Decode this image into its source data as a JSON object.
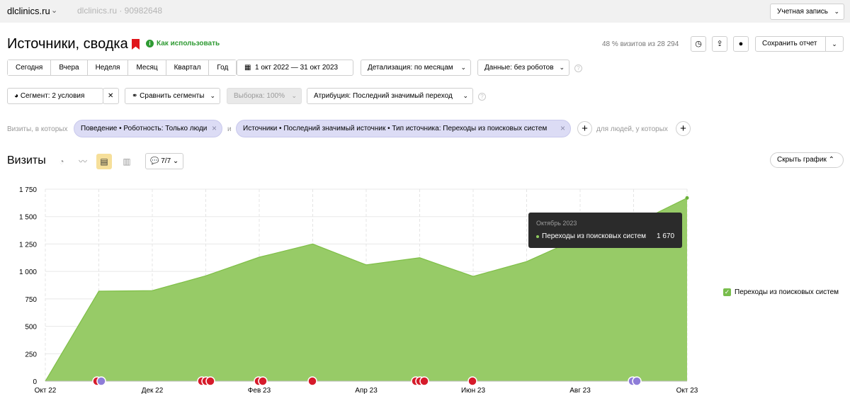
{
  "header": {
    "site": "dlclinics.ru",
    "counter": "dlclinics.ru · 90982648",
    "account": "Учетная запись"
  },
  "report": {
    "title": "Источники, сводка",
    "howto": "Как использовать",
    "visits_share": "48 % визитов из 28 294",
    "save": "Сохранить отчет"
  },
  "filters": {
    "periods": [
      "Сегодня",
      "Вчера",
      "Неделя",
      "Месяц",
      "Квартал",
      "Год"
    ],
    "date_range": "1 окт 2022 — 31 окт 2023",
    "detail": "Детализация: по месяцам",
    "data": "Данные: без роботов",
    "segment": "Сегмент: 2 условия",
    "compare": "Сравнить сегменты",
    "sample": "Выборка: 100%",
    "attribution": "Атрибуция: Последний значимый переход"
  },
  "segments": {
    "label": "Визиты, в которых",
    "chip1": "Поведение • Роботность: Только люди",
    "and": "и",
    "chip2": "Источники • Последний значимый источник • Тип источника: Переходы из поисковых систем",
    "people": "для людей, у которых"
  },
  "chart_section": {
    "title": "Визиты",
    "annotations": "7/7",
    "hide": "Скрыть график"
  },
  "tooltip": {
    "title": "Октябрь 2023",
    "series": "Переходы из поисковых систем",
    "value": "1 670"
  },
  "colors": {
    "area": "#97cb67",
    "accent": "#e0151a",
    "green": "#2e9a32"
  },
  "chart_data": {
    "type": "area",
    "x": [
      "2022-10",
      "2022-11",
      "2022-12",
      "2023-01",
      "2023-02",
      "2023-03",
      "2023-04",
      "2023-05",
      "2023-06",
      "2023-07",
      "2023-08",
      "2023-09",
      "2023-10"
    ],
    "xtick_labels": [
      "Окт 22",
      "Дек 22",
      "Фев 23",
      "Апр 23",
      "Июн 23",
      "Авг 23",
      "Окт 23"
    ],
    "xtick_index": [
      0,
      2,
      4,
      6,
      8,
      10,
      12
    ],
    "yticks": [
      0,
      250,
      500,
      750,
      1000,
      1250,
      1500,
      1750
    ],
    "ytick_labels": [
      "0",
      "250",
      "500",
      "750",
      "1 000",
      "1 250",
      "1 500",
      "1 750"
    ],
    "ylim": [
      0,
      1750
    ],
    "series": [
      {
        "name": "Переходы из поисковых систем",
        "values": [
          0,
          820,
          825,
          960,
          1130,
          1250,
          1060,
          1125,
          955,
          1090,
          1310,
          1430,
          1670
        ]
      }
    ],
    "grid": true,
    "legend": "right"
  }
}
